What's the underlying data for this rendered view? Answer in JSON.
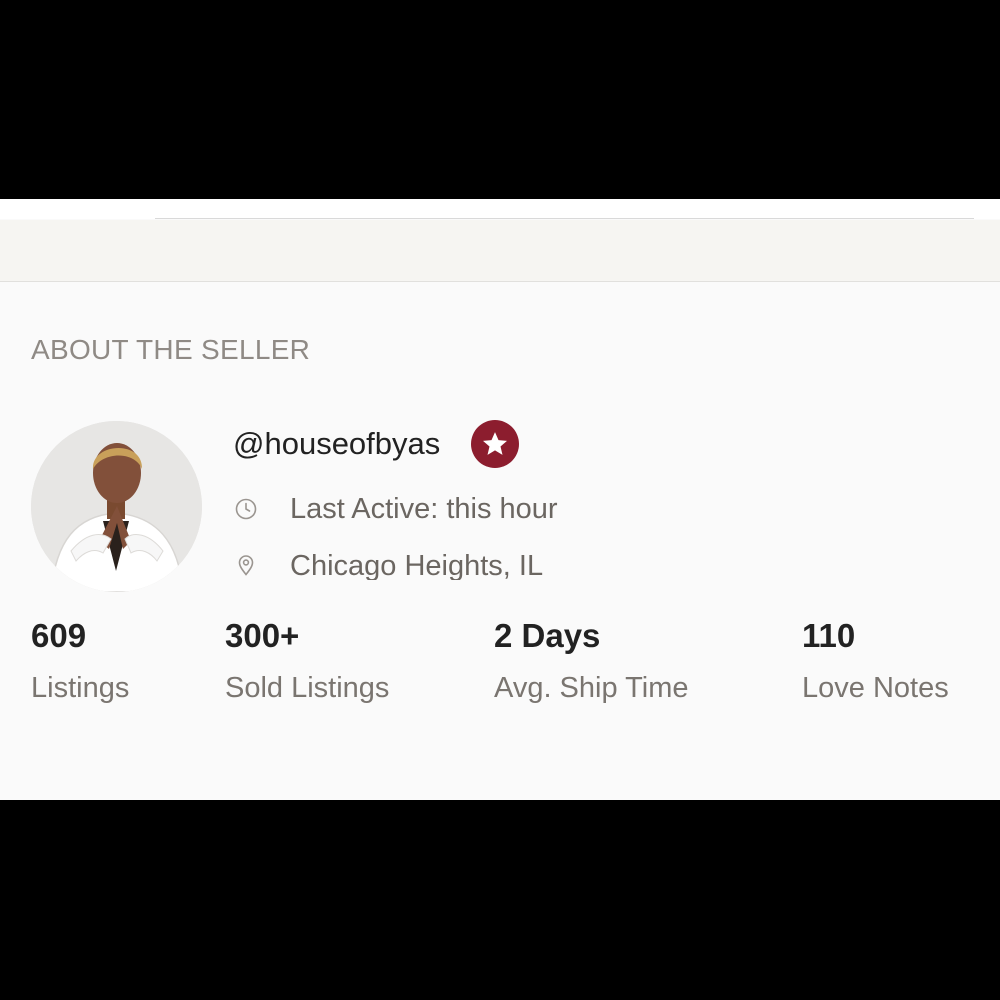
{
  "section": {
    "title": "ABOUT THE SELLER"
  },
  "seller": {
    "username": "@houseofbyas",
    "badge_icon": "star-icon",
    "badge_color": "#8c1d2e",
    "last_active": "Last Active: this hour",
    "location": "Chicago Heights, IL"
  },
  "stats": [
    {
      "value": "609",
      "label": "Listings"
    },
    {
      "value": "300+",
      "label": "Sold Listings"
    },
    {
      "value": "2 Days",
      "label": "Avg. Ship Time"
    },
    {
      "value": "110",
      "label": "Love Notes"
    }
  ]
}
